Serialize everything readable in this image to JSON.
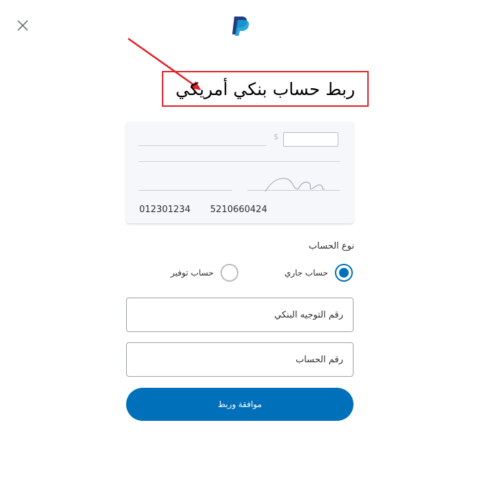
{
  "dialog": {
    "title": "ربط حساب بنكي أمريكي"
  },
  "check_illustration": {
    "routing_number": "012301234",
    "account_number": "5210660424",
    "currency_symbol": "$"
  },
  "account_type": {
    "label": "نوع الحساب",
    "options": [
      {
        "label": "حساب جاري",
        "selected": true
      },
      {
        "label": "حساب توفير",
        "selected": false
      }
    ]
  },
  "fields": {
    "routing_placeholder": "رقم التوجيه البنكي",
    "account_placeholder": "رقم الحساب"
  },
  "actions": {
    "submit_label": "موافقة وربط"
  },
  "colors": {
    "brand": "#0070ba",
    "annotation": "#e01f26"
  },
  "icons": {
    "close": "close-icon",
    "logo": "paypal-logo"
  }
}
